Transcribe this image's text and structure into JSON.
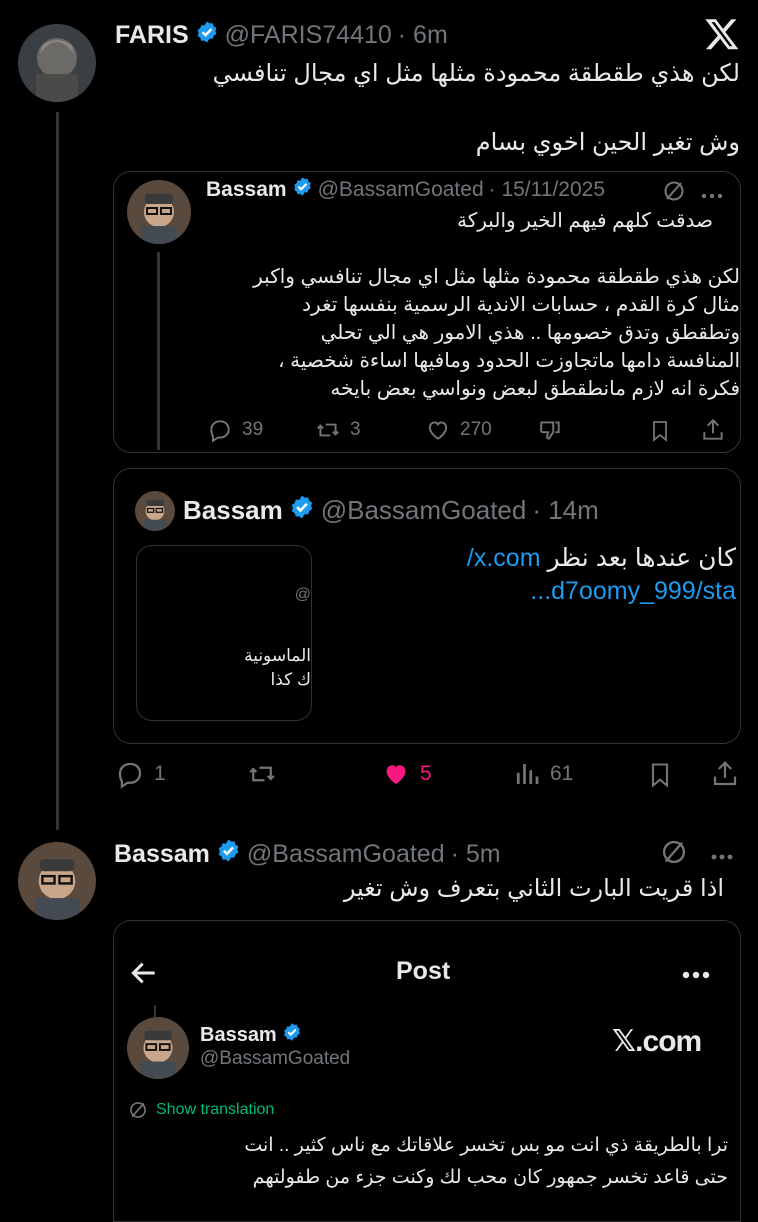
{
  "tweet1": {
    "name": "FARIS",
    "handle": "@FARIS74410",
    "time": "· 6m",
    "line1": "لكن هذي طقطقة محمودة مثلها مثل اي مجال تنافسي",
    "line2": "وش تغير الحين اخوي بسام",
    "stats": {
      "replies": "1",
      "retweets": "",
      "likes": "5",
      "views": "61"
    }
  },
  "quote1": {
    "name": "Bassam",
    "handle": "@BassamGoated",
    "date": "· 15/11/2025",
    "line1": "صدقت كلهم فيهم الخير والبركة",
    "lines": [
      "لكن هذي طقطقة محمودة مثلها مثل اي مجال تنافسي واكبر",
      "مثال كرة القدم ، حسابات الاندية الرسمية بنفسها تغرد",
      "وتطقطق وتدق خصومها .. هذي الامور هي الي تحلي",
      "المنافسة دامها ماتجاوزت الحدود ومافيها اساءة شخصية ،",
      "فكرة انه لازم مانطقطق لبعض ونواسي بعض بايخه"
    ],
    "stats": {
      "replies": "39",
      "retweets": "3",
      "likes": "270"
    }
  },
  "quote2": {
    "name": "Bassam",
    "handle": "@BassamGoated",
    "time": "· 14m",
    "text": "كان عندها بعد نظر",
    "link1": "x.com/",
    "link2": "...d7oomy_999/sta",
    "thumb_line0": "@",
    "thumb_line1": "الماسونية",
    "thumb_line2": "ك كذا"
  },
  "tweet2": {
    "name": "Bassam",
    "handle": "@BassamGoated",
    "time": "· 5m",
    "text": "اذا قريت البارت الثاني بتعرف وش تغير"
  },
  "screenshot": {
    "header": "Post",
    "name": "Bassam",
    "handle": "@BassamGoated",
    "brand": "𝕏.com",
    "translate": "Show translation",
    "line1": "ترا بالطريقة ذي انت مو بس تخسر علاقاتك مع ناس كثير .. انت",
    "line2": "حتى قاعد تخسر جمهور كان محب لك وكنت جزء من طفولتهم"
  },
  "colors": {
    "accent": "#1d9bf0",
    "like": "#f91880",
    "muted": "#71767b",
    "border": "#2f3336"
  }
}
